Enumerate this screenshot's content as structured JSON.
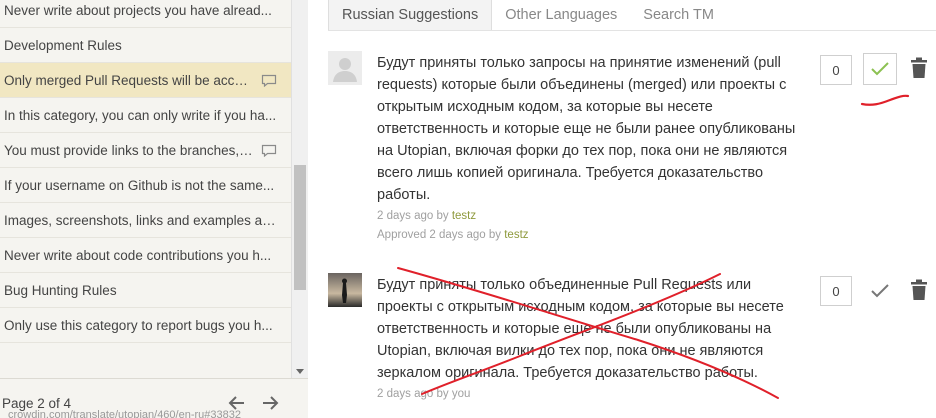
{
  "sidebar": {
    "items": [
      {
        "label": "Never write about projects you have alread...",
        "comment": false,
        "active": false
      },
      {
        "label": "Development Rules",
        "comment": false,
        "active": false
      },
      {
        "label": "Only merged Pull Requests will be acce...",
        "comment": true,
        "active": true
      },
      {
        "label": "In this category, you can only write if you ha...",
        "comment": false,
        "active": false
      },
      {
        "label": "You must provide links to the branches, ...",
        "comment": true,
        "active": false
      },
      {
        "label": "If your username on Github is not the same...",
        "comment": false,
        "active": false
      },
      {
        "label": "Images, screenshots, links and examples ar...",
        "comment": false,
        "active": false
      },
      {
        "label": "Never write about code contributions you h...",
        "comment": false,
        "active": false
      },
      {
        "label": "Bug Hunting Rules",
        "comment": false,
        "active": false
      },
      {
        "label": "Only use this category to report bugs you h...",
        "comment": false,
        "active": false
      }
    ],
    "pager": {
      "label": "Page 2 of 4",
      "url": "crowdin.com/translate/utopian/460/en-ru#33832"
    }
  },
  "tabs": [
    {
      "label": "Russian Suggestions",
      "active": true
    },
    {
      "label": "Other Languages",
      "active": false
    },
    {
      "label": "Search TM",
      "active": false
    }
  ],
  "suggestions": [
    {
      "text": "Будут приняты только запросы на принятие изменений (pull requests) которые были объединены (merged) или проекты с открытым исходным кодом, за которые вы несете ответственность и которые еще не были ранее опубликованы на Utopian, включая форки до тех пор, пока они не являются всего лишь копией оригинала. Требуется доказательство работы.",
      "meta_prefix": "2 days ago by ",
      "meta_user": "testz",
      "approved_prefix": "Approved 2 days ago by ",
      "approved_user": "testz",
      "votes": "0",
      "approved": true
    },
    {
      "text": "Будут приняты только объединенные Pull Requests или проекты с открытым исходным кодом, за которые вы несете ответственность и которые еще не были опубликованы на Utopian, включая вилки до тех пор, пока они не являются зеркалом оригинала. Требуется доказательство работы.",
      "meta_prefix": "2 days ago by ",
      "meta_user": "you",
      "votes": "0",
      "approved": false
    }
  ],
  "colors": {
    "accent_green": "#8cc152",
    "annotation_red": "#e0202a",
    "active_row": "#f1e7c2"
  }
}
